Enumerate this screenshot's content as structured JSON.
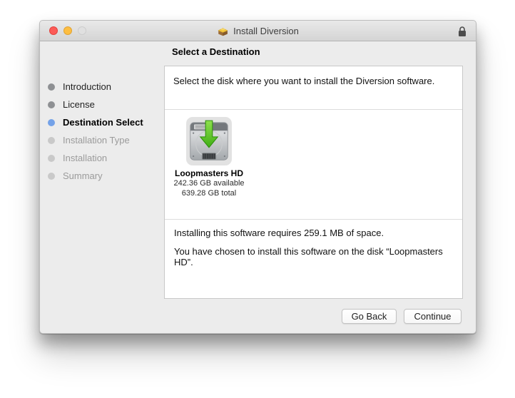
{
  "window": {
    "title": "Install Diversion",
    "traffic_lights": [
      "close",
      "minimize",
      "zoom-disabled"
    ]
  },
  "sidebar": {
    "items": [
      {
        "label": "Introduction",
        "state": "done"
      },
      {
        "label": "License",
        "state": "done"
      },
      {
        "label": "Destination Select",
        "state": "current"
      },
      {
        "label": "Installation Type",
        "state": "pending"
      },
      {
        "label": "Installation",
        "state": "pending"
      },
      {
        "label": "Summary",
        "state": "pending"
      }
    ]
  },
  "content": {
    "heading": "Select a Destination",
    "instruction": "Select the disk where you want to install the Diversion software.",
    "disk": {
      "name": "Loopmasters HD",
      "available": "242.36 GB available",
      "total": "639.28 GB total",
      "icon": "hard-drive-with-green-download-arrow"
    },
    "info": {
      "requirement": "Installing this software requires 259.1 MB of space.",
      "chosen": "You have chosen to install this software on the disk “Loopmasters HD”."
    }
  },
  "footer": {
    "back_label": "Go Back",
    "continue_label": "Continue"
  },
  "colors": {
    "current_step_blue": "#74a2e8",
    "arrow_green": "#56c421",
    "traffic_red": "#fc5b57",
    "traffic_yellow": "#fdbe41",
    "traffic_gray": "#e0e0e0"
  }
}
